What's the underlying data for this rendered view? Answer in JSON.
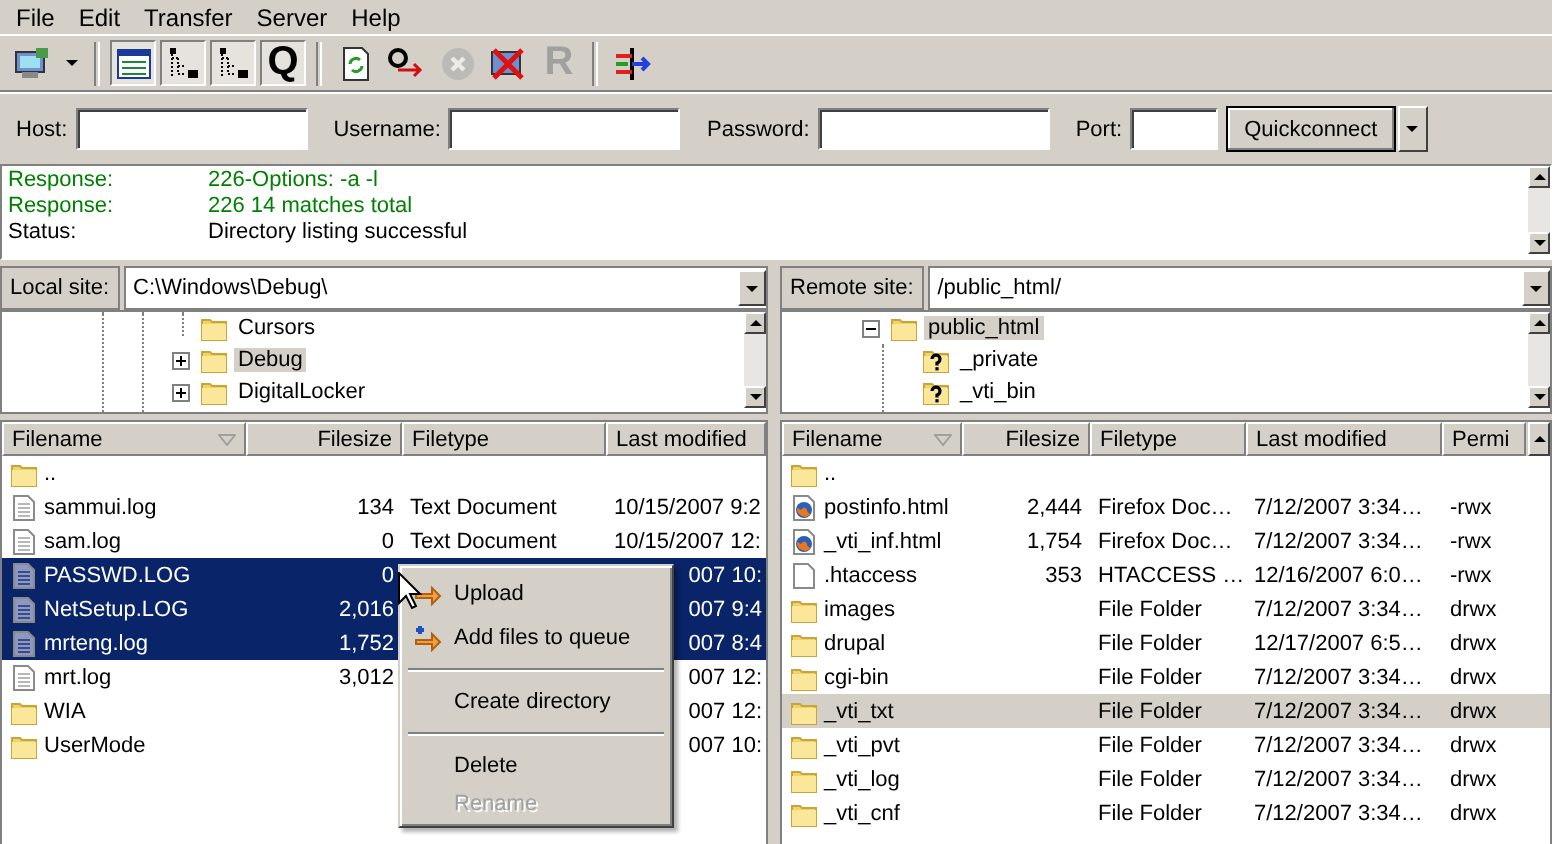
{
  "menu_bar": [
    "File",
    "Edit",
    "Transfer",
    "Server",
    "Help"
  ],
  "toolbar": [
    {
      "kind": "site_manager",
      "pressed": false,
      "disabled": false
    },
    {
      "kind": "dropdown",
      "pressed": false,
      "disabled": false
    },
    {
      "kind": "message_log",
      "pressed": true,
      "disabled": false
    },
    {
      "kind": "local_tree",
      "pressed": true,
      "disabled": false
    },
    {
      "kind": "remote_tree",
      "pressed": true,
      "disabled": false
    },
    {
      "kind": "queue",
      "label": "Q",
      "pressed": true,
      "disabled": false
    },
    {
      "kind": "refresh",
      "pressed": false,
      "disabled": false
    },
    {
      "kind": "process_queue",
      "pressed": false,
      "disabled": false
    },
    {
      "kind": "cancel",
      "pressed": false,
      "disabled": true
    },
    {
      "kind": "disconnect",
      "pressed": false,
      "disabled": false
    },
    {
      "kind": "reconnect",
      "label": "R",
      "pressed": false,
      "disabled": true
    },
    {
      "kind": "compare",
      "pressed": false,
      "disabled": false
    }
  ],
  "quickconnect": {
    "fields": [
      {
        "label": "Host:"
      },
      {
        "label": "Username:"
      },
      {
        "label": "Password:"
      },
      {
        "label": "Port:"
      }
    ],
    "button": "Quickconnect"
  },
  "log": [
    {
      "kind": "response",
      "label": "Response:",
      "message": "226-Options: -a -l"
    },
    {
      "kind": "response",
      "label": "Response:",
      "message": "226 14 matches total"
    },
    {
      "kind": "status",
      "label": "Status:",
      "message": "Directory listing successful"
    }
  ],
  "local": {
    "site_label": "Local site:",
    "path": "C:\\Windows\\Debug\\",
    "tree": [
      {
        "kind": "leaf",
        "name": "Cursors",
        "selected": false
      },
      {
        "kind": "node",
        "name": "Debug",
        "expanded": false,
        "selected": true
      },
      {
        "kind": "node",
        "name": "DigitalLocker",
        "expanded": false,
        "selected": false
      }
    ],
    "columns": [
      "Filename",
      "Filesize",
      "Filetype",
      "Last modified"
    ],
    "files": [
      {
        "kind": "folder",
        "name": "..",
        "selected": false
      },
      {
        "kind": "text",
        "name": "sammui.log",
        "size": "134",
        "type": "Text Document",
        "modified": "10/15/2007 9:2",
        "selected": false
      },
      {
        "kind": "text",
        "name": "sam.log",
        "size": "0",
        "type": "Text Document",
        "modified": "10/15/2007 12:",
        "selected": false
      },
      {
        "kind": "text",
        "name": "PASSWD.LOG",
        "size": "0",
        "modified": "007 10:",
        "selected": true
      },
      {
        "kind": "text",
        "name": "NetSetup.LOG",
        "size": "2,016",
        "modified": "007 9:4",
        "selected": true
      },
      {
        "kind": "text",
        "name": "mrteng.log",
        "size": "1,752",
        "modified": "007 8:4",
        "selected": true
      },
      {
        "kind": "text",
        "name": "mrt.log",
        "size": "3,012",
        "modified": "007 12:",
        "selected": false
      },
      {
        "kind": "folder",
        "name": "WIA",
        "modified": "007 12:",
        "selected": false
      },
      {
        "kind": "folder",
        "name": "UserMode",
        "modified": "007 10:",
        "selected": false
      }
    ]
  },
  "remote": {
    "site_label": "Remote site:",
    "path": "/public_html/",
    "tree": [
      {
        "kind": "node",
        "name": "public_html",
        "expanded": true,
        "selected": true,
        "children": [
          {
            "kind": "unknown",
            "name": "_private",
            "selected": false
          },
          {
            "kind": "unknown",
            "name": "_vti_bin",
            "selected": false
          }
        ]
      }
    ],
    "columns": [
      "Filename",
      "Filesize",
      "Filetype",
      "Last modified",
      "Permi"
    ],
    "files": [
      {
        "kind": "folder",
        "name": "..",
        "selected": false
      },
      {
        "kind": "web",
        "name": "postinfo.html",
        "size": "2,444",
        "type": "Firefox Doc…",
        "modified": "7/12/2007 3:34…",
        "permissions": "-rwx",
        "selected": false
      },
      {
        "kind": "web",
        "name": "_vti_inf.html",
        "size": "1,754",
        "type": "Firefox Doc…",
        "modified": "7/12/2007 3:34…",
        "permissions": "-rwx",
        "selected": false
      },
      {
        "kind": "blank",
        "name": ".htaccess",
        "size": "353",
        "type": "HTACCESS …",
        "modified": "12/16/2007 6:0…",
        "permissions": "-rwx",
        "selected": false
      },
      {
        "kind": "folder",
        "name": "images",
        "type": "File Folder",
        "modified": "7/12/2007 3:34…",
        "permissions": "drwx",
        "selected": false
      },
      {
        "kind": "folder",
        "name": "drupal",
        "type": "File Folder",
        "modified": "12/17/2007 6:5…",
        "permissions": "drwx",
        "selected": false
      },
      {
        "kind": "folder",
        "name": "cgi-bin",
        "type": "File Folder",
        "modified": "7/12/2007 3:34…",
        "permissions": "drwx",
        "selected": false
      },
      {
        "kind": "folder",
        "name": "_vti_txt",
        "type": "File Folder",
        "modified": "7/12/2007 3:34…",
        "permissions": "drwx",
        "selected": true
      },
      {
        "kind": "folder",
        "name": "_vti_pvt",
        "type": "File Folder",
        "modified": "7/12/2007 3:34…",
        "permissions": "drwx",
        "selected": false
      },
      {
        "kind": "folder",
        "name": "_vti_log",
        "type": "File Folder",
        "modified": "7/12/2007 3:34…",
        "permissions": "drwx",
        "selected": false
      },
      {
        "kind": "folder",
        "name": "_vti_cnf",
        "type": "File Folder",
        "modified": "7/12/2007 3:34…",
        "permissions": "drwx",
        "selected": false
      }
    ]
  },
  "context_menu": [
    {
      "kind": "upload",
      "label": "Upload",
      "disabled": false
    },
    {
      "kind": "queue",
      "label": "Add files to queue",
      "disabled": false
    },
    {
      "kind": "separator"
    },
    {
      "kind": "plain",
      "label": "Create directory",
      "disabled": false
    },
    {
      "kind": "separator"
    },
    {
      "kind": "plain",
      "label": "Delete",
      "disabled": false
    },
    {
      "kind": "plain",
      "label": "Rename",
      "disabled": true
    }
  ]
}
